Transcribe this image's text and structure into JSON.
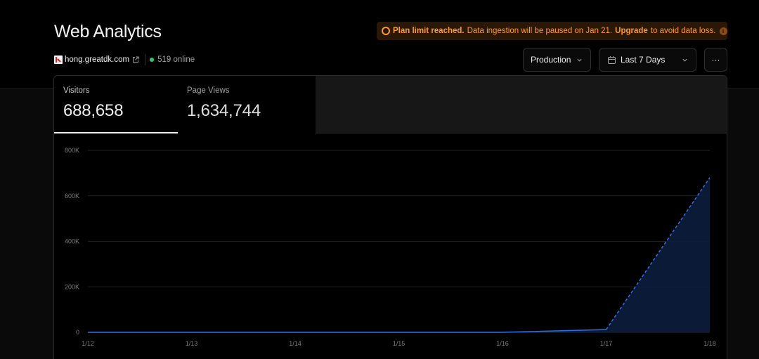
{
  "header": {
    "title": "Web Analytics",
    "site": "hong.greatdk.com",
    "online": "519 online"
  },
  "banner": {
    "strong": "Plan limit reached.",
    "text": "Data ingestion will be paused on Jan 21.",
    "link": "Upgrade",
    "tail": "to avoid data loss.",
    "info": "i"
  },
  "controls": {
    "environment": "Production",
    "range": "Last 7 Days",
    "more": "···"
  },
  "tabs": [
    {
      "label": "Visitors",
      "value": "688,658"
    },
    {
      "label": "Page Views",
      "value": "1,634,744"
    }
  ],
  "colors": {
    "accent": "#2f6fe8",
    "warning": "#ff9a2e",
    "online": "#2fc76a"
  },
  "chart_data": {
    "type": "area",
    "series_label": "Visitors",
    "x": [
      "1/12",
      "1/13",
      "1/14",
      "1/15",
      "1/16",
      "1/17",
      "1/18"
    ],
    "values": [
      0,
      0,
      0,
      0,
      0,
      12000,
      680000
    ],
    "dashed_from_index": 5,
    "y_ticks": [
      0,
      200000,
      400000,
      600000,
      800000
    ],
    "y_tick_labels": [
      "0",
      "200K",
      "400K",
      "600K",
      "800K"
    ],
    "ylim": [
      0,
      800000
    ],
    "grid": true
  }
}
